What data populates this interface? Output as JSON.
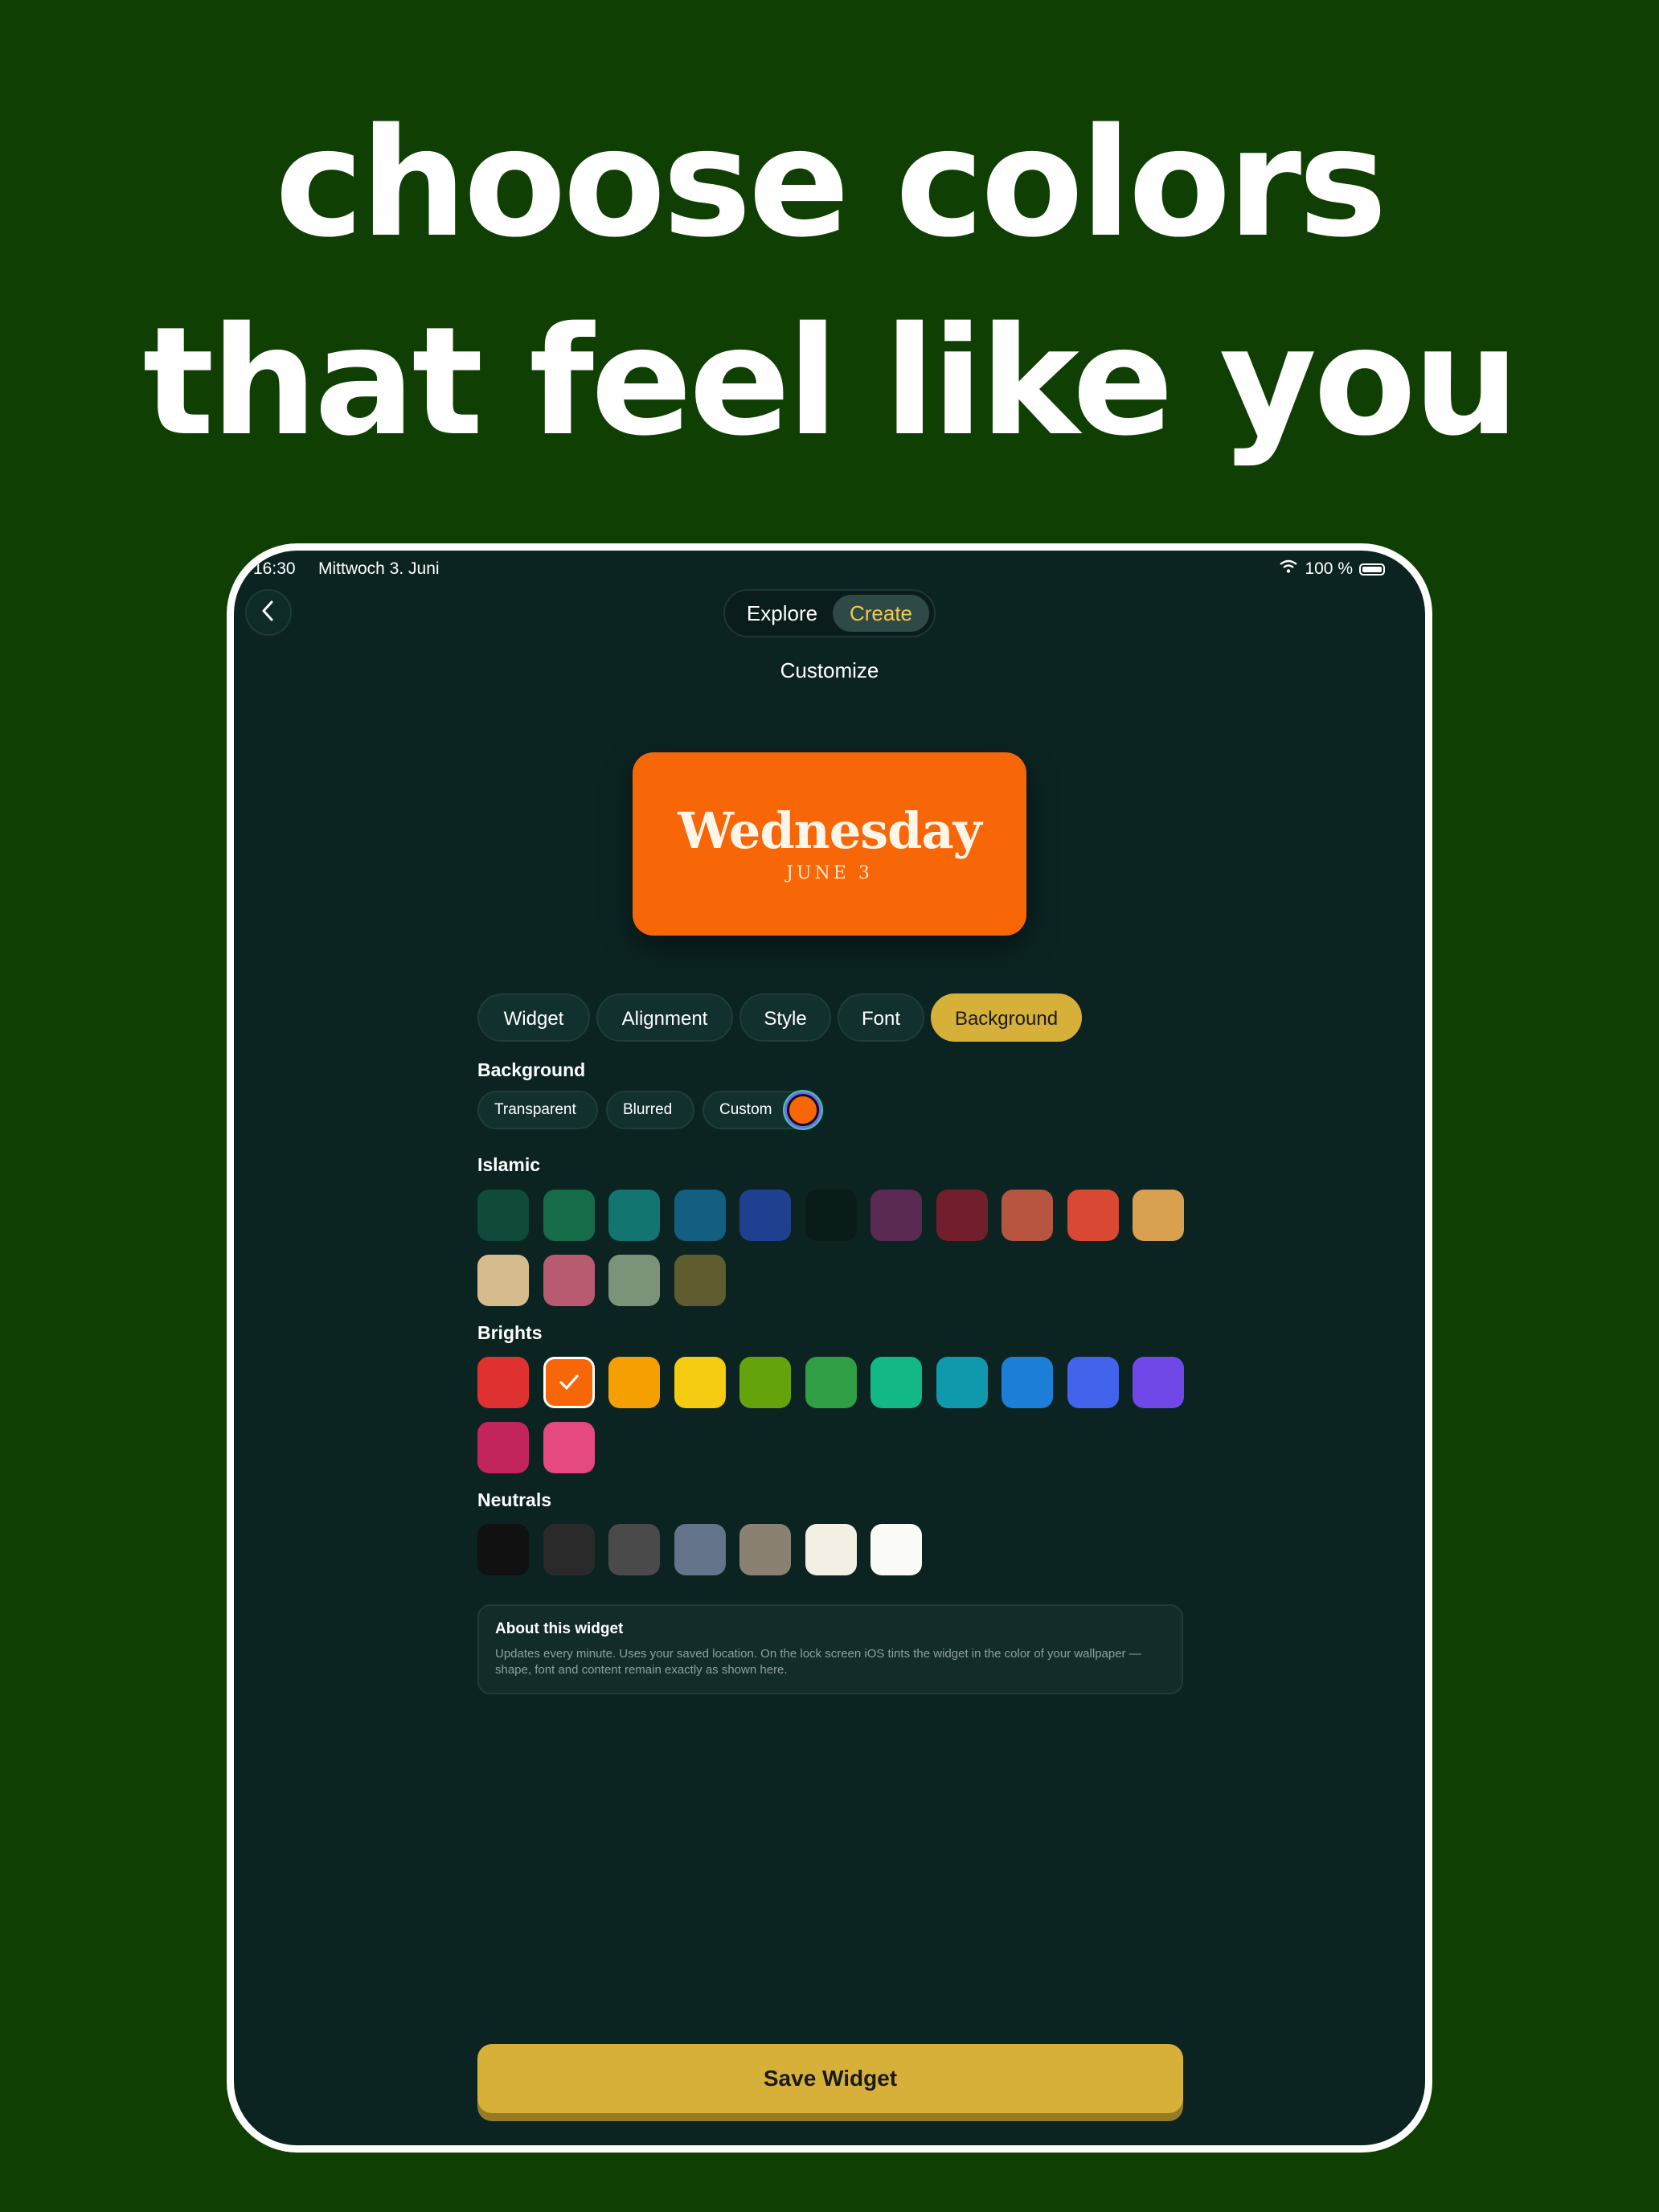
{
  "headline": {
    "line1": "choose colors",
    "line2": "that feel like you"
  },
  "status_bar": {
    "time": "16:30",
    "date": "Mittwoch 3. Juni",
    "battery": "100 %"
  },
  "nav": {
    "tabs": [
      "Explore",
      "Create"
    ],
    "active_tab": "Create"
  },
  "screen_title": "Customize",
  "preview": {
    "day": "Wednesday",
    "date": "JUNE 3",
    "background_color": "#f76707"
  },
  "editor_tabs": {
    "items": [
      "Widget",
      "Alignment",
      "Style",
      "Font",
      "Background"
    ],
    "active": "Background"
  },
  "background": {
    "label": "Background",
    "options": [
      "Transparent",
      "Blurred",
      "Custom"
    ],
    "custom_color": "#f76707"
  },
  "palettes": {
    "islamic": {
      "label": "Islamic",
      "colors": [
        "#0f4a3b",
        "#166b48",
        "#12756f",
        "#145f81",
        "#1f3f91",
        "#0a1c1a",
        "#5a2a52",
        "#731e2c",
        "#b85540",
        "#d94832",
        "#d8a04f",
        "#d5bc8c",
        "#b85b70",
        "#7d9379",
        "#5f5d2f"
      ]
    },
    "brights": {
      "label": "Brights",
      "colors": [
        "#e03131",
        "#f76707",
        "#f59f00",
        "#f5cc12",
        "#65a30d",
        "#2f9e44",
        "#12b886",
        "#1098ad",
        "#1c7ed6",
        "#4263eb",
        "#7048e8",
        "#c2255c",
        "#e64980"
      ],
      "selected_index": 1
    },
    "neutrals": {
      "label": "Neutrals",
      "colors": [
        "#111111",
        "#2a2a2a",
        "#4a4a4a",
        "#64748b",
        "#8b8173",
        "#f3efe5",
        "#fafaf7"
      ]
    }
  },
  "about": {
    "title": "About this widget",
    "body": "Updates every minute. Uses your saved location. On the lock screen iOS tints the widget in the color of your wallpaper — shape, font and content remain exactly as shown here."
  },
  "save_button": "Save Widget",
  "accent_color": "#d6b038"
}
